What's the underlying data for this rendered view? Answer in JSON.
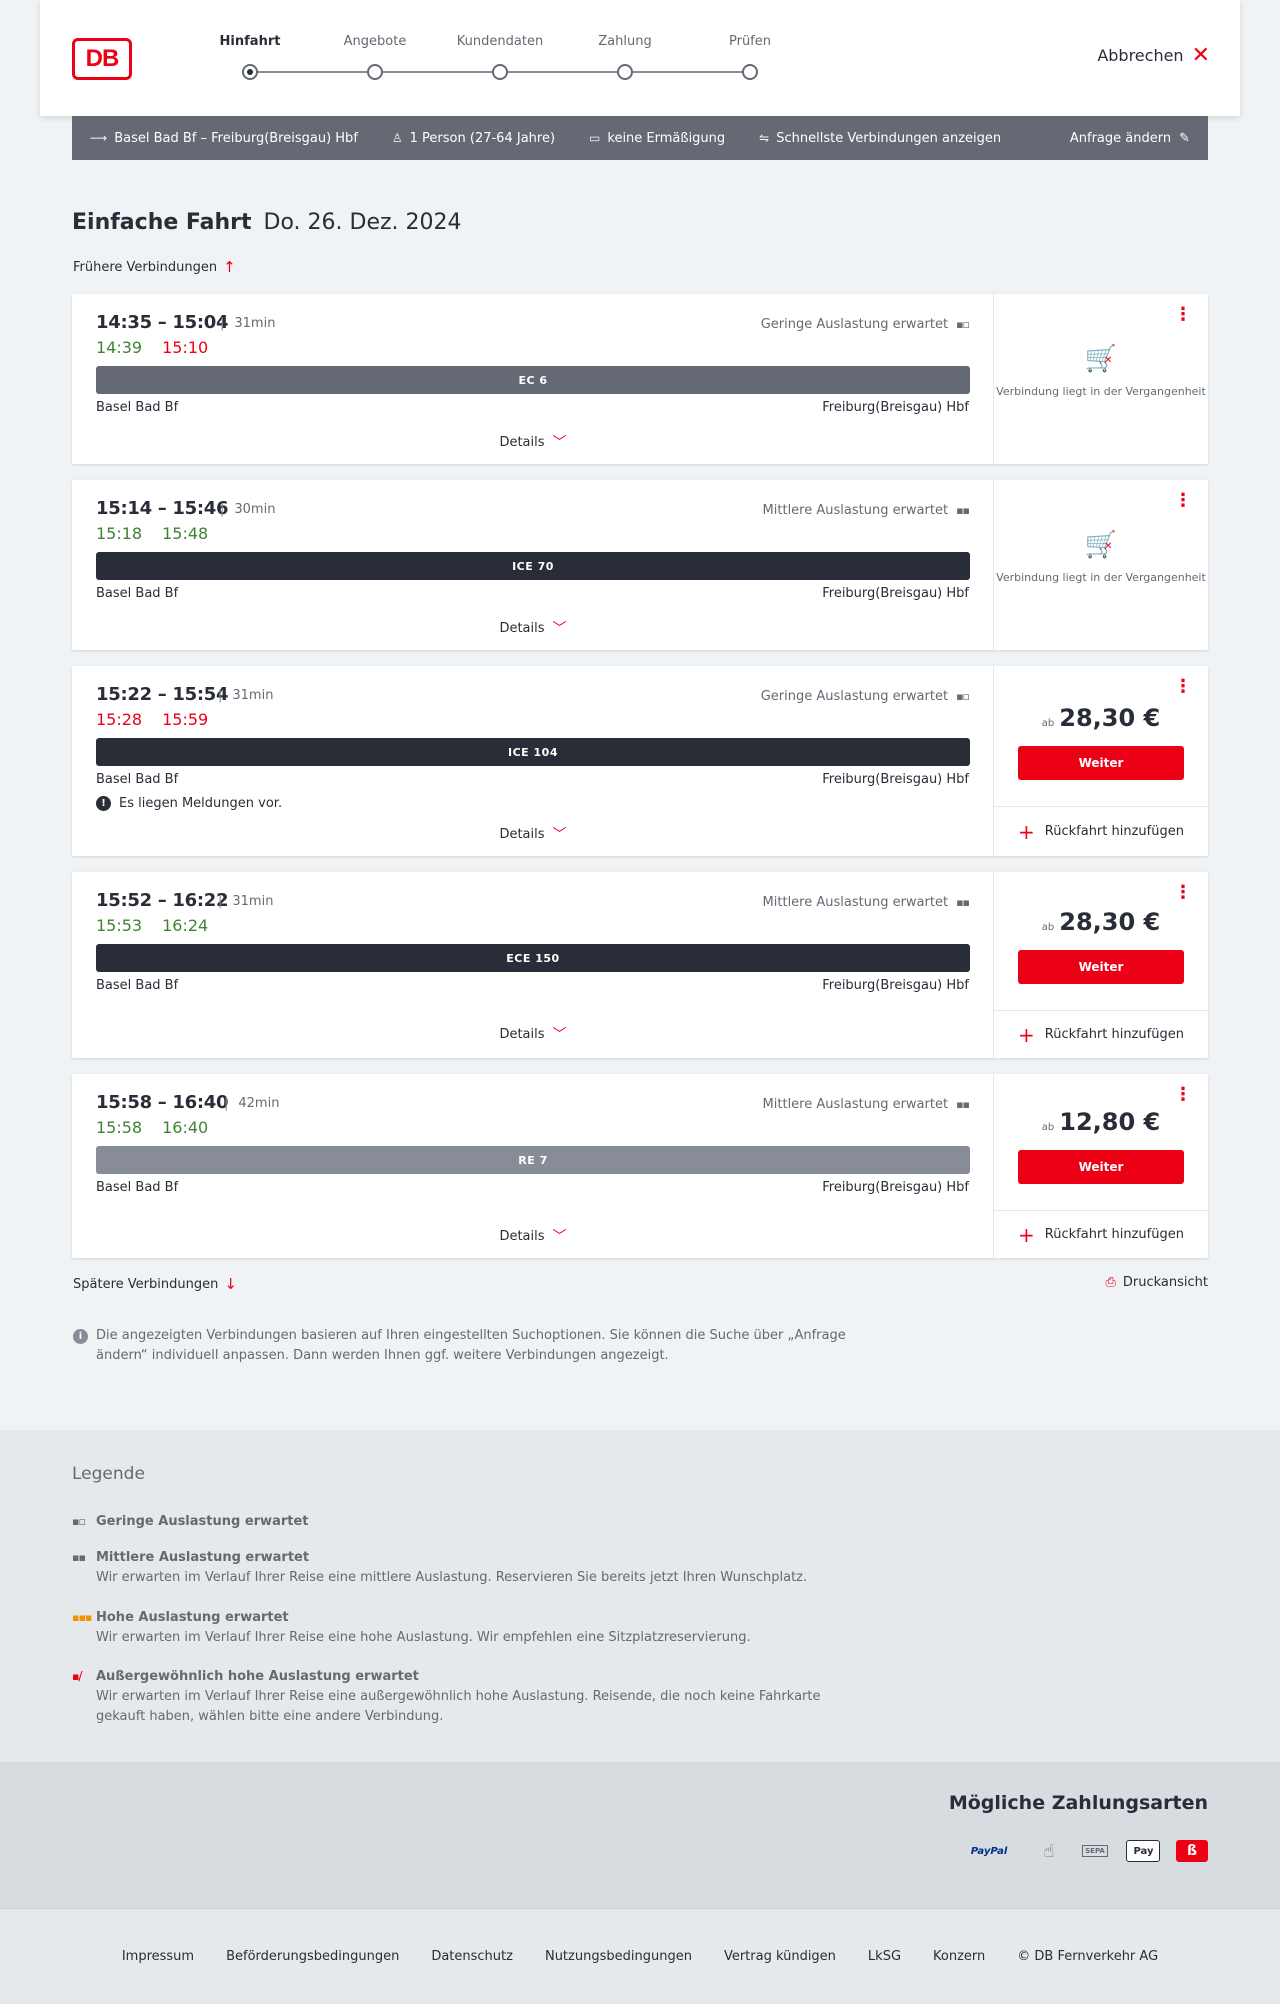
{
  "header": {
    "steps": [
      "Hinfahrt",
      "Angebote",
      "Kundendaten",
      "Zahlung",
      "Prüfen"
    ],
    "cancel_label": "Abbrechen"
  },
  "search": {
    "route": "Basel Bad Bf – Freiburg(Breisgau) Hbf",
    "passengers": "1 Person (27-64 Jahre)",
    "discount": "keine Ermäßigung",
    "option": "Schnellste Verbindungen anzeigen",
    "edit_label": "Anfrage ändern"
  },
  "page": {
    "title": "Einfache Fahrt",
    "date": "Do. 26. Dez. 2024",
    "earlier": "Frühere Verbindungen",
    "later": "Spätere Verbindungen",
    "print": "Druckansicht",
    "info": "Die angezeigten Verbindungen basieren auf Ihren eingestellten Suchoptionen. Sie können die Suche über „Anfrage ändern“ individuell anpassen. Dann werden Ihnen ggf. weitere Verbindungen angezeigt."
  },
  "connections": [
    {
      "time": "14:35 – 15:04",
      "duration": "31min",
      "rt_dep": "14:39",
      "rt_arr": "15:10",
      "load": "Geringe Auslastung erwartet",
      "train": "EC 6",
      "from": "Basel Bad Bf",
      "to": "Freiburg(Breisgau) Hbf",
      "details": "Details",
      "past": "Verbindung liegt in der Vergangenheit"
    },
    {
      "time": "15:14 – 15:46",
      "duration": "30min",
      "rt_dep": "15:18",
      "rt_arr": "15:48",
      "load": "Mittlere Auslastung erwartet",
      "train": "ICE 70",
      "from": "Basel Bad Bf",
      "to": "Freiburg(Breisgau) Hbf",
      "details": "Details",
      "past": "Verbindung liegt in der Vergangenheit"
    },
    {
      "time": "15:22 – 15:54",
      "duration": "31min",
      "rt_dep": "15:28",
      "rt_arr": "15:59",
      "load": "Geringe Auslastung erwartet",
      "train": "ICE 104",
      "from": "Basel Bad Bf",
      "to": "Freiburg(Breisgau) Hbf",
      "message": "Es liegen Meldungen vor.",
      "details": "Details",
      "price_prefix": "ab",
      "price": "28,30 €",
      "button": "Weiter",
      "return": "Rückfahrt hinzufügen"
    },
    {
      "time": "15:52 – 16:22",
      "duration": "31min",
      "rt_dep": "15:53",
      "rt_arr": "16:24",
      "load": "Mittlere Auslastung erwartet",
      "train": "ECE 150",
      "from": "Basel Bad Bf",
      "to": "Freiburg(Breisgau) Hbf",
      "details": "Details",
      "price_prefix": "ab",
      "price": "28,30 €",
      "button": "Weiter",
      "return": "Rückfahrt hinzufügen"
    },
    {
      "time": "15:58 – 16:40",
      "duration": "42min",
      "rt_dep": "15:58",
      "rt_arr": "16:40",
      "load": "Mittlere Auslastung erwartet",
      "train": "RE 7",
      "from": "Basel Bad Bf",
      "to": "Freiburg(Breisgau) Hbf",
      "details": "Details",
      "price_prefix": "ab",
      "price": "12,80 €",
      "button": "Weiter",
      "return": "Rückfahrt hinzufügen"
    }
  ],
  "legend": {
    "title": "Legende",
    "items": [
      {
        "title": "Geringe Auslastung erwartet",
        "text": ""
      },
      {
        "title": "Mittlere Auslastung erwartet",
        "text": "Wir erwarten im Verlauf Ihrer Reise eine mittlere Auslastung. Reservieren Sie bereits jetzt Ihren Wunschplatz."
      },
      {
        "title": "Hohe Auslastung erwartet",
        "text": "Wir erwarten im Verlauf Ihrer Reise eine hohe Auslastung. Wir empfehlen eine Sitzplatzreservierung."
      },
      {
        "title": "Außergewöhnlich hohe Auslastung erwartet",
        "text": "Wir erwarten im Verlauf Ihrer Reise eine außergewöhnlich hohe Auslastung. Reisende, die noch keine Fahrkarte gekauft haben, wählen bitte eine andere Verbindung."
      }
    ]
  },
  "payment": {
    "title": "Mögliche Zahlungsarten",
    "paypal": "PayPal",
    "sepa": "SEPA",
    "apple": "Pay"
  },
  "footer": [
    "Impressum",
    "Beförderungsbedingungen",
    "Datenschutz",
    "Nutzungsbedingungen",
    "Vertrag kündigen",
    "LkSG",
    "Konzern",
    "© DB Fernverkehr AG"
  ],
  "colors": {
    "accent": "#ec0016",
    "ontime": "#408335",
    "dark": "#282d37",
    "bar_gray": "#646973"
  }
}
